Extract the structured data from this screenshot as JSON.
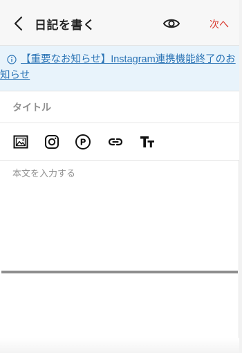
{
  "header": {
    "title": "日記を書く",
    "next_label": "次へ"
  },
  "notice": {
    "text": "【重要なお知らせ】Instagram連携機能終了のお知らせ"
  },
  "title_field": {
    "placeholder": "タイトル"
  },
  "toolbar": {
    "tools": [
      "image-icon",
      "instagram-icon",
      "parking-p-icon",
      "link-icon",
      "text-size-icon"
    ]
  },
  "body_field": {
    "placeholder": "本文を入力する"
  },
  "colors": {
    "accent": "#d9372c",
    "link": "#2a73b5",
    "notice_bg": "#e8f3fb"
  }
}
